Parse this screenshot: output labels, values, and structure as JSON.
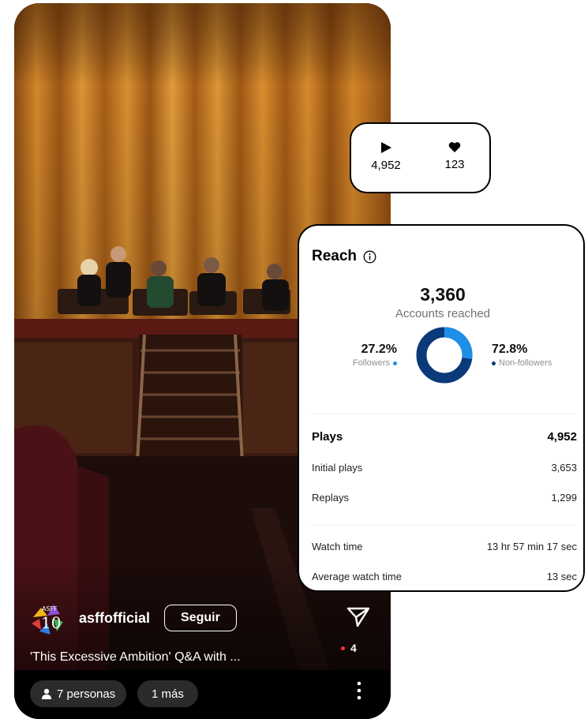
{
  "reel": {
    "username": "asffofficial",
    "follow_label": "Seguir",
    "caption": "'This Excessive Ambition' Q&A with ...",
    "share_count": "4",
    "chips": {
      "people": "7 personas",
      "more": "1 más"
    },
    "logo_text": "ASFF 10"
  },
  "stats_bubble": {
    "plays": "4,952",
    "likes": "123"
  },
  "reach": {
    "title": "Reach",
    "accounts_reached_value": "3,360",
    "accounts_reached_label": "Accounts reached",
    "followers_pct": "27.2%",
    "followers_label": "Followers",
    "non_followers_pct": "72.8%",
    "non_followers_label": "Non-followers",
    "followers_share": 0.272,
    "colors": {
      "followers": "#1e8fe6",
      "non_followers": "#0b3a7a"
    },
    "plays": {
      "label": "Plays",
      "value": "4,952"
    },
    "initial_plays": {
      "label": "Initial plays",
      "value": "3,653"
    },
    "replays": {
      "label": "Replays",
      "value": "1,299"
    },
    "watch_time": {
      "label": "Watch time",
      "value": "13 hr 57 min 17 sec"
    },
    "average_watch_time": {
      "label": "Average watch time",
      "value": "13 sec"
    }
  }
}
